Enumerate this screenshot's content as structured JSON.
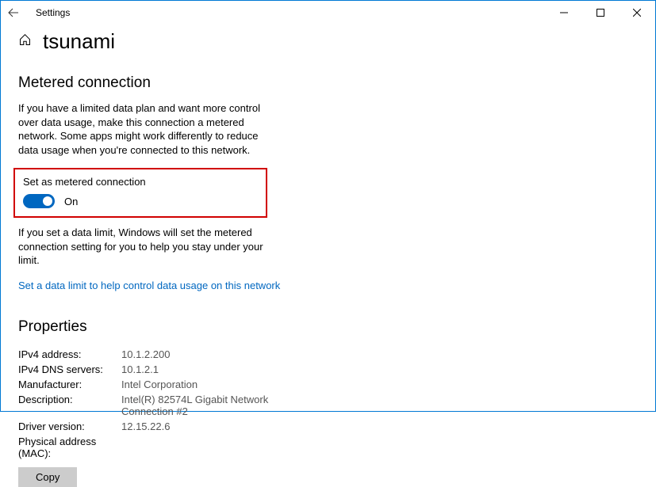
{
  "titlebar": {
    "title": "Settings"
  },
  "page": {
    "name": "tsunami"
  },
  "metered": {
    "heading": "Metered connection",
    "description": "If you have a limited data plan and want more control over data usage, make this connection a metered network. Some apps might work differently to reduce data usage when you're connected to this network.",
    "toggle_label": "Set as metered connection",
    "toggle_state": "On",
    "toggle_on": true,
    "post_text": "If you set a data limit, Windows will set the metered connection setting for you to help you stay under your limit.",
    "link": "Set a data limit to help control data usage on this network"
  },
  "properties": {
    "heading": "Properties",
    "rows": [
      {
        "key": "IPv4 address:",
        "val": "10.1.2.200"
      },
      {
        "key": "IPv4 DNS servers:",
        "val": "10.1.2.1"
      },
      {
        "key": "Manufacturer:",
        "val": "Intel Corporation"
      },
      {
        "key": "Description:",
        "val": "Intel(R) 82574L Gigabit Network Connection #2"
      },
      {
        "key": "Driver version:",
        "val": "12.15.22.6"
      },
      {
        "key": "Physical address (MAC):",
        "val": ""
      }
    ],
    "copy_label": "Copy"
  }
}
